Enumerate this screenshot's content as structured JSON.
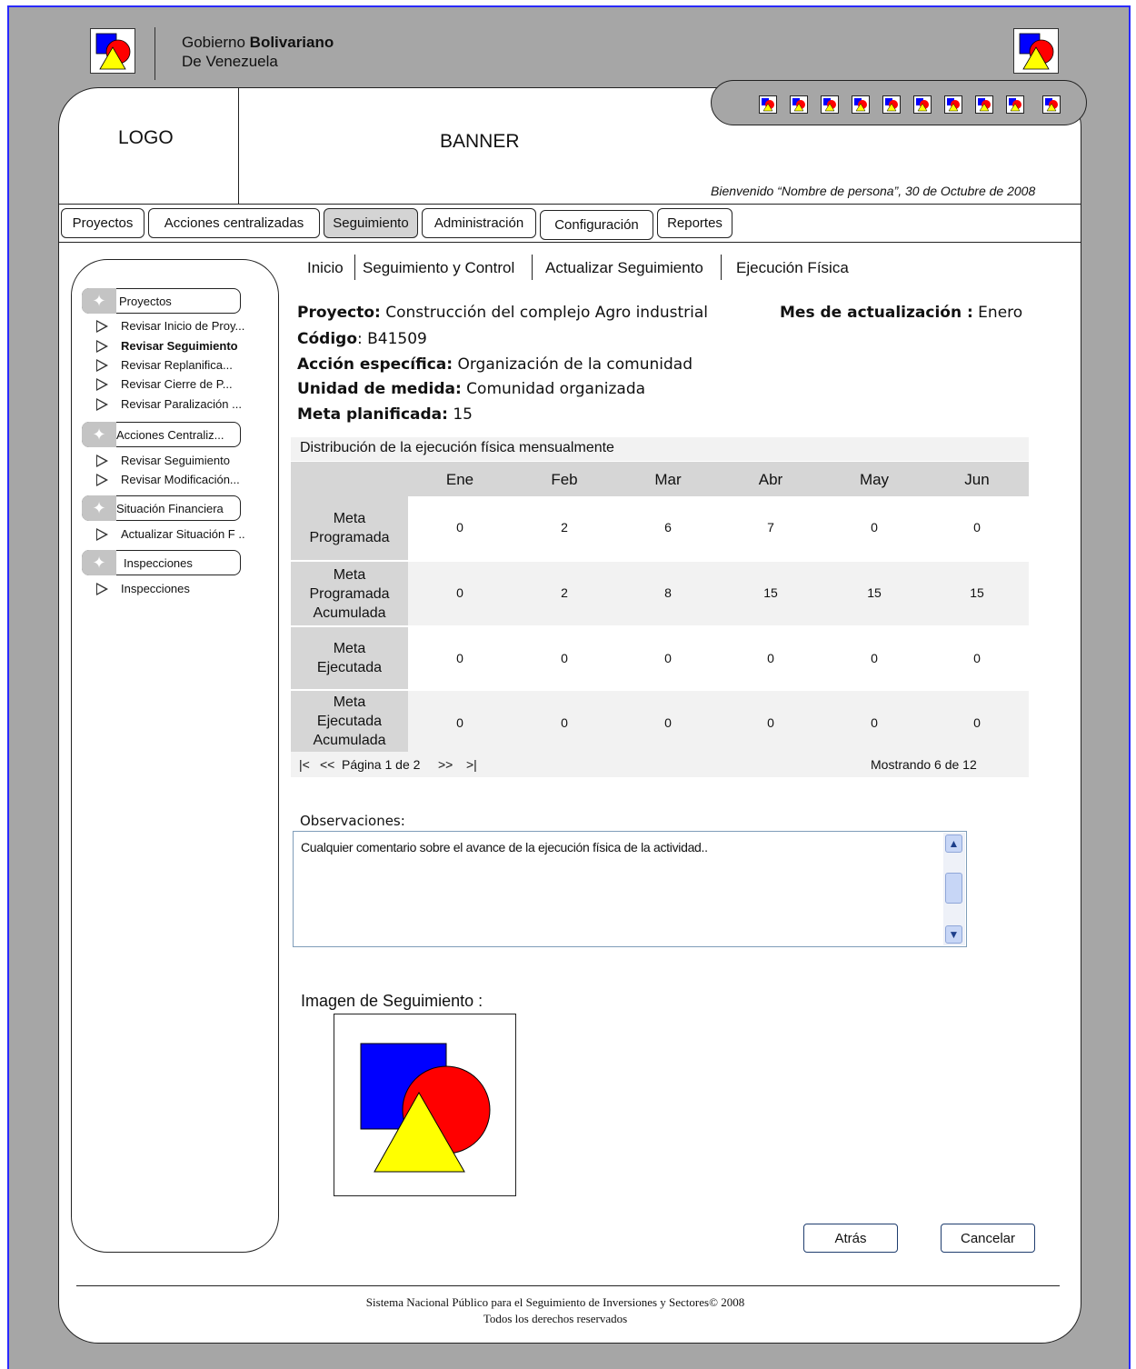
{
  "header": {
    "gov_line1_prefix": "Gobierno ",
    "gov_line1_bold": "Bolivariano",
    "gov_line2": "De Venezuela",
    "logo_placeholder": "LOGO",
    "banner_placeholder": "BANNER",
    "welcome": "Bienvenido “Nombre de persona”, 30 de Octubre de 2008"
  },
  "tabs": [
    "Proyectos",
    "Acciones centralizadas",
    "Seguimiento",
    "Administración",
    "Configuración",
    "Reportes"
  ],
  "sidebar": {
    "sections": [
      {
        "label": "Proyectos",
        "items": [
          "Revisar Inicio de Proy...",
          "Revisar Seguimiento",
          "Revisar Replanifica...",
          "Revisar Cierre de P...",
          "Revisar Paralización ..."
        ]
      },
      {
        "label": "Acciones Centraliz...",
        "items": [
          "Revisar Seguimiento",
          "Revisar Modificación..."
        ]
      },
      {
        "label": "Situación Financiera",
        "items": [
          "Actualizar Situación F .."
        ]
      },
      {
        "label": "Inspecciones",
        "items": [
          "Inspecciones"
        ]
      }
    ]
  },
  "breadcrumb": [
    "Inicio",
    "Seguimiento y Control",
    "Actualizar Seguimiento",
    "Ejecución Física"
  ],
  "project": {
    "proyecto_label": "Proyecto:",
    "proyecto_value": " Construcción del complejo Agro industrial",
    "mes_label": "Mes de actualización :",
    "mes_value": " Enero",
    "codigo_label": "Código",
    "codigo_value": ": B41509",
    "accion_label": "Acción específica:",
    "accion_value": " Organización de la comunidad",
    "unidad_label": "Unidad de medida:",
    "unidad_value": " Comunidad organizada",
    "meta_label": "Meta planificada:",
    "meta_value": " 15"
  },
  "table": {
    "caption": "Distribución de la ejecución física mensualmente",
    "columns": [
      "Ene",
      "Feb",
      "Mar",
      "Abr",
      "May",
      "Jun"
    ],
    "rows": [
      {
        "label_lines": [
          "Meta",
          "Programada"
        ],
        "values": [
          "0",
          "2",
          "6",
          "7",
          "0",
          "0"
        ]
      },
      {
        "label_lines": [
          "Meta",
          "Programada",
          "Acumulada"
        ],
        "values": [
          "0",
          "2",
          "8",
          "15",
          "15",
          "15"
        ]
      },
      {
        "label_lines": [
          "Meta",
          "Ejecutada"
        ],
        "values": [
          "0",
          "0",
          "0",
          "0",
          "0",
          "0"
        ]
      },
      {
        "label_lines": [
          "Meta",
          "Ejecutada",
          "Acumulada"
        ],
        "values": [
          "0",
          "0",
          "0",
          "0",
          "0",
          "0"
        ]
      }
    ],
    "pager_first": "|<",
    "pager_prev": "<<",
    "pager_text": "Página 1 de 2",
    "pager_next": ">>",
    "pager_last": ">|",
    "showing": "Mostrando 6 de 12"
  },
  "observaciones": {
    "label": "Observaciones:",
    "value": "Cualquier comentario sobre el avance de la ejecución física de la actividad.."
  },
  "imagen": {
    "label": "Imagen de Seguimiento :"
  },
  "buttons": {
    "back": "Atrás",
    "cancel": "Cancelar"
  },
  "footer": {
    "line1": "Sistema Nacional Público para el Seguimiento de Inversiones y Sectores© 2008",
    "line2": "Todos los derechos reservados"
  },
  "colors": {
    "logo_blue": "#0000ff",
    "logo_red": "#ff0000",
    "logo_yellow": "#ffff00",
    "frame_gray": "#a6a6a6",
    "active_tab": "#d4d4d4"
  }
}
